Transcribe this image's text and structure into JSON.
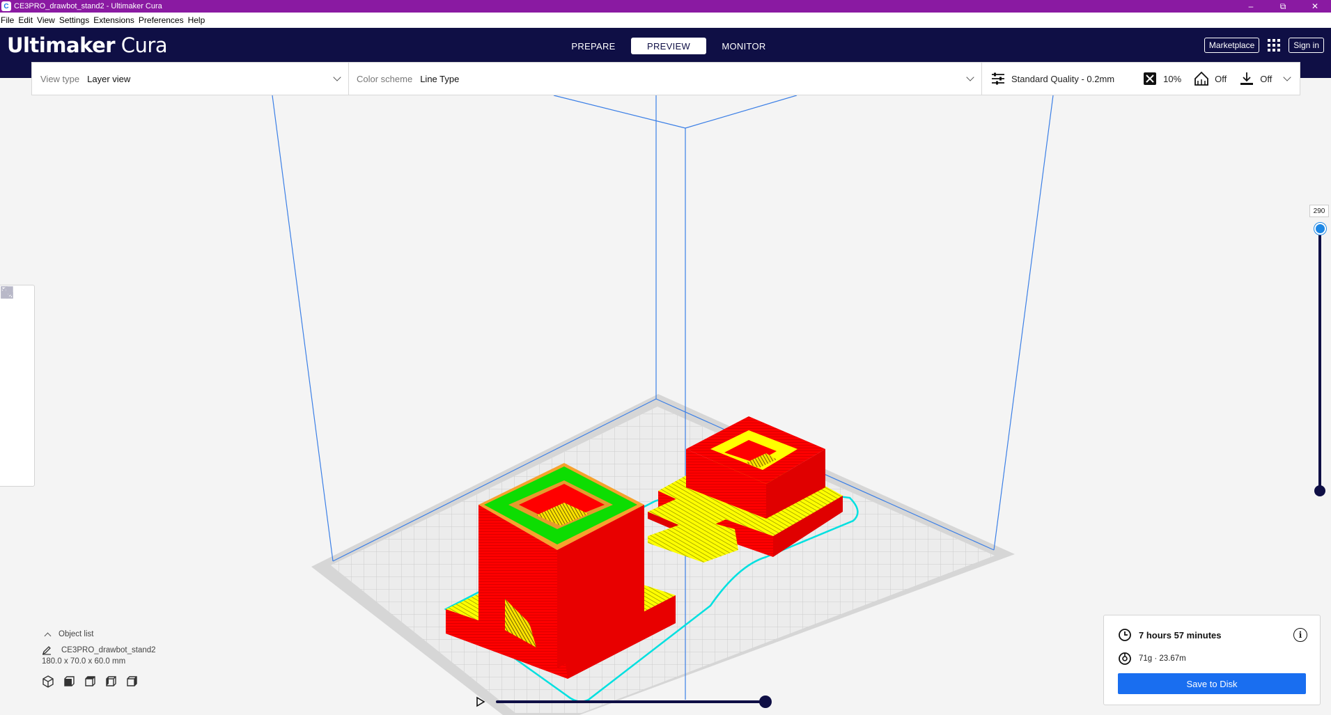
{
  "window": {
    "title": "CE3PRO_drawbot_stand2 - Ultimaker Cura",
    "app_icon": "C",
    "controls": [
      "minimize-icon",
      "restore-icon",
      "close-icon"
    ]
  },
  "menu": [
    "File",
    "Edit",
    "View",
    "Settings",
    "Extensions",
    "Preferences",
    "Help"
  ],
  "header": {
    "logo_bold": "Ultimaker",
    "logo_light": "Cura",
    "stages": [
      {
        "label": "PREPARE",
        "active": false
      },
      {
        "label": "PREVIEW",
        "active": true
      },
      {
        "label": "MONITOR",
        "active": false
      }
    ],
    "marketplace_label": "Marketplace",
    "signin_label": "Sign in"
  },
  "toolbar": {
    "view_type_label": "View type",
    "view_type_value": "Layer view",
    "color_scheme_label": "Color scheme",
    "color_scheme_value": "Line Type",
    "profile": "Standard Quality - 0.2mm",
    "infill": "10%",
    "support": "Off",
    "adhesion": "Off"
  },
  "left_tools": [
    "move-icon",
    "scale-icon",
    "rotate-icon",
    "mirror-icon",
    "per-model-settings-icon",
    "support-blocker-icon"
  ],
  "layer_slider": {
    "top_layer": "290"
  },
  "object_list": {
    "toggle_label": "Object list",
    "object_name": "CE3PRO_drawbot_stand2",
    "dimensions": "180.0 x 70.0 x 60.0 mm"
  },
  "print_info": {
    "time": "7 hours 57 minutes",
    "material": "71g · 23.67m",
    "save_label": "Save to Disk"
  },
  "colors": {
    "titlebar": "#8a1aa2",
    "header": "#0f0f45",
    "accent": "#196ef0",
    "wall": "#ff0000",
    "skin": "#ffff00",
    "infill": "#e69a2e",
    "inner_wall": "#00ff00",
    "skirt": "#00e5e5"
  }
}
